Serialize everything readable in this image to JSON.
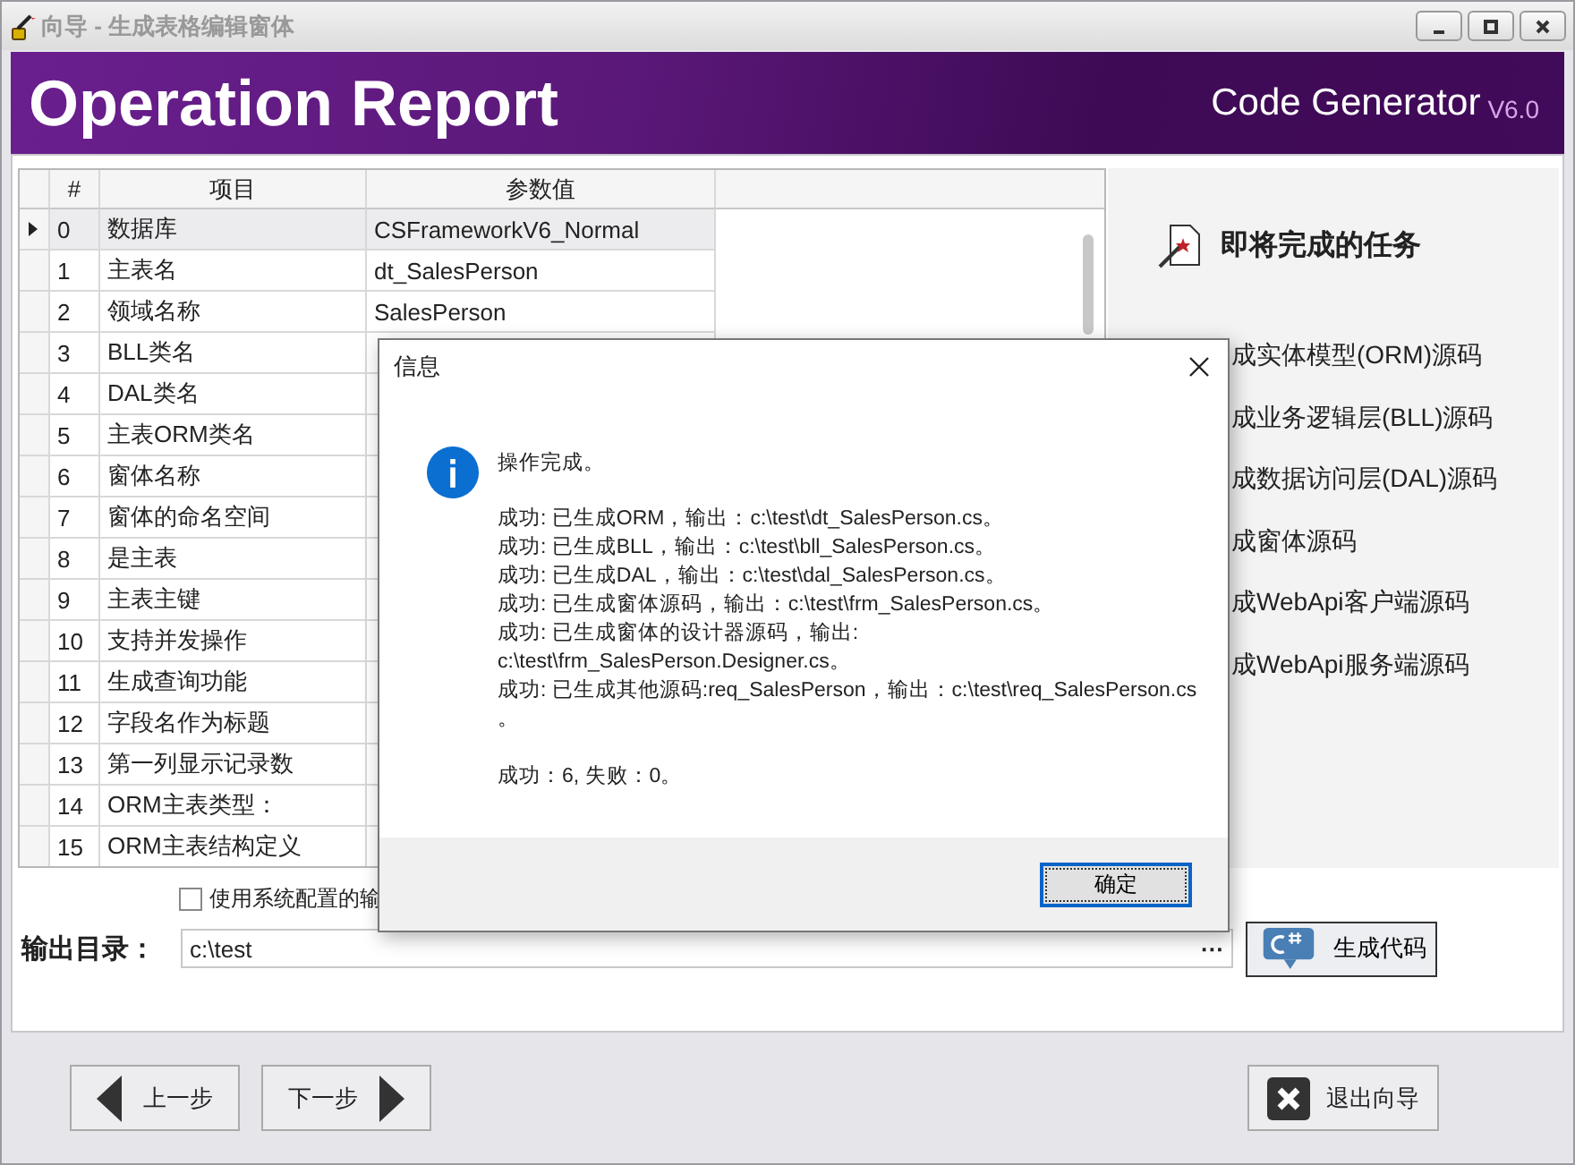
{
  "window": {
    "title": "向导 - 生成表格编辑窗体"
  },
  "banner": {
    "title": "Operation Report",
    "product": "Code Generator",
    "version": "V6.0"
  },
  "grid": {
    "columns": [
      "#",
      "项目",
      "参数值"
    ],
    "rows": [
      {
        "index": "0",
        "item": "数据库",
        "value": "CSFrameworkV6_Normal",
        "selected": true
      },
      {
        "index": "1",
        "item": "主表名",
        "value": "dt_SalesPerson",
        "selected": false
      },
      {
        "index": "2",
        "item": "领域名称",
        "value": "SalesPerson",
        "selected": false
      },
      {
        "index": "3",
        "item": "BLL类名",
        "selected": false
      },
      {
        "index": "4",
        "item": "DAL类名",
        "selected": false
      },
      {
        "index": "5",
        "item": "主表ORM类名",
        "selected": false
      },
      {
        "index": "6",
        "item": "窗体名称",
        "selected": false
      },
      {
        "index": "7",
        "item": "窗体的命名空间",
        "selected": false
      },
      {
        "index": "8",
        "item": "是主表",
        "selected": false
      },
      {
        "index": "9",
        "item": "主表主键",
        "selected": false
      },
      {
        "index": "10",
        "item": "支持并发操作",
        "selected": false
      },
      {
        "index": "11",
        "item": "生成查询功能",
        "selected": false
      },
      {
        "index": "12",
        "item": "字段名作为标题",
        "selected": false
      },
      {
        "index": "13",
        "item": "第一列显示记录数",
        "selected": false
      },
      {
        "index": "14",
        "item": "ORM主表类型：",
        "selected": false
      },
      {
        "index": "15",
        "item": "ORM主表结构定义",
        "selected": false
      }
    ]
  },
  "tasks": {
    "title": "即将完成的任务",
    "items": [
      "成实体模型(ORM)源码",
      "成业务逻辑层(BLL)源码",
      "成数据访问层(DAL)源码",
      "成窗体源码",
      "成WebApi客户端源码",
      "成WebApi服务端源码"
    ]
  },
  "use_system_config": {
    "label": "使用系统配置的输",
    "checked": false
  },
  "output": {
    "label": "输出目录：",
    "value": "c:\\test",
    "browse": "···",
    "generate_button": "生成代码"
  },
  "footer": {
    "prev_button": "上一步",
    "next_button": "下一步",
    "exit_button": "退出向导"
  },
  "dialog": {
    "title": "信息",
    "message": "操作完成。",
    "lines": [
      "成功: 已生成ORM，输出：c:\\test\\dt_SalesPerson.cs。",
      "成功: 已生成BLL，输出：c:\\test\\bll_SalesPerson.cs。",
      "成功: 已生成DAL，输出：c:\\test\\dal_SalesPerson.cs。",
      "成功: 已生成窗体源码，输出：c:\\test\\frm_SalesPerson.cs。",
      "成功: 已生成窗体的设计器源码，输出:",
      "c:\\test\\frm_SalesPerson.Designer.cs。",
      "成功: 已生成其他源码:req_SalesPerson，输出：c:\\test\\req_SalesPerson.cs",
      "。"
    ],
    "summary": "成功：6, 失败：0。",
    "ok_button": "确定"
  }
}
